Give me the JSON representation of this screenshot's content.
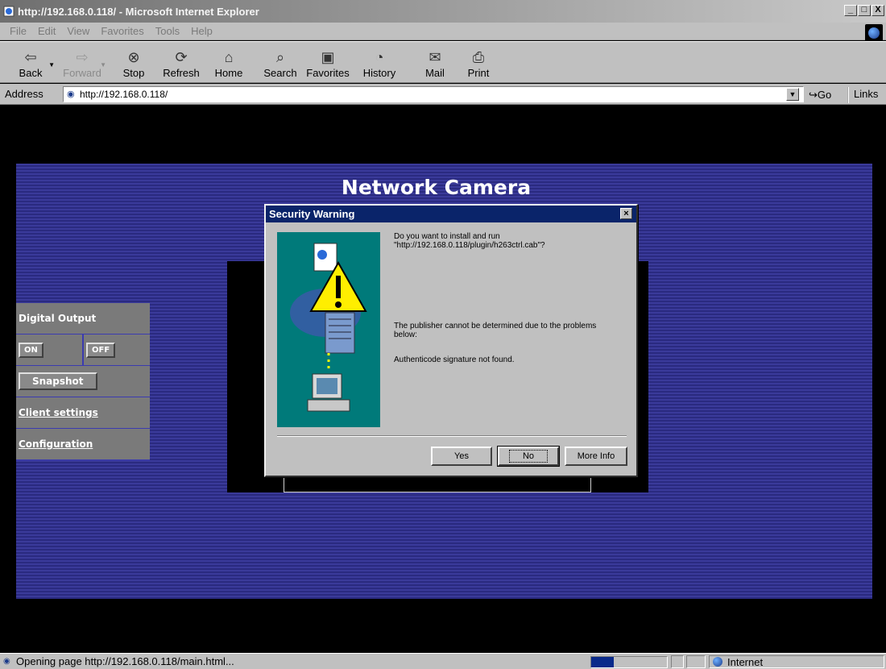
{
  "window": {
    "title": "http://192.168.0.118/ - Microsoft Internet Explorer",
    "controls": [
      "_",
      "□",
      "X"
    ]
  },
  "menu": [
    "File",
    "Edit",
    "View",
    "Favorites",
    "Tools",
    "Help"
  ],
  "toolbar": {
    "back": "Back",
    "forward": "Forward",
    "stop": "Stop",
    "refresh": "Refresh",
    "home": "Home",
    "search": "Search",
    "favorites": "Favorites",
    "history": "History",
    "mail": "Mail",
    "print": "Print"
  },
  "address": {
    "label": "Address",
    "url": "http://192.168.0.118/",
    "go": "Go",
    "links": "Links"
  },
  "camera": {
    "title": "Network Camera",
    "sidebar": {
      "digital_output": "Digital Output",
      "on": "ON",
      "off": "OFF",
      "snapshot": "Snapshot",
      "client_settings": "Client settings",
      "configuration": "Configuration"
    }
  },
  "dialog": {
    "title": "Security Warning",
    "question_line1": "Do you want to install and run",
    "question_line2": "\"http://192.168.0.118/plugin/h263ctrl.cab\"?",
    "publisher_line1": "The publisher cannot be determined due to the problems",
    "publisher_line2": "below:",
    "signature": "Authenticode signature not found.",
    "yes": "Yes",
    "no": "No",
    "more_info": "More Info"
  },
  "status": {
    "text": "Opening page http://192.168.0.118/main.html...",
    "zone": "Internet",
    "progress_fraction": 0.3
  },
  "colors": {
    "panel": "#2a2a80",
    "dialog_title": "#0a246a",
    "illustration": "#007a7a"
  }
}
